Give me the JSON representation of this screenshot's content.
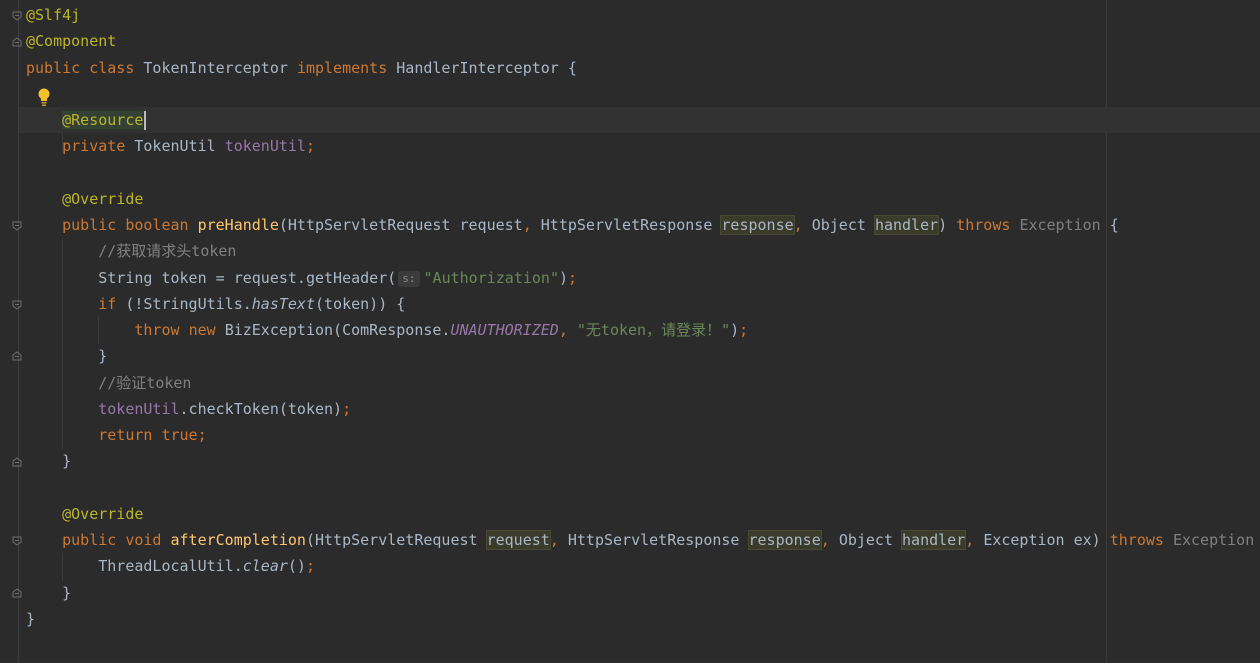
{
  "editor": {
    "lines": {
      "l1": "@Slf4j",
      "l2": "@Component",
      "l3": {
        "kw1": "public",
        "kw2": "class",
        "name": "TokenInterceptor",
        "kw3": "implements",
        "iface": "HandlerInterceptor",
        "brace": "{"
      },
      "l5": {
        "ann": "@Resource"
      },
      "l6": {
        "kw": "private",
        "type": "TokenUtil",
        "field": "tokenUtil",
        "semi": ";"
      },
      "l8": "@Override",
      "l9": {
        "kw1": "public",
        "kw2": "boolean",
        "method": "preHandle",
        "open": "(",
        "t1": "HttpServletRequest",
        "p1": "request",
        "comma1": ",",
        "t2": "HttpServletResponse",
        "p2": "response",
        "comma2": ",",
        "t3": "Object",
        "p3": "handler",
        "close": ")",
        "throws": "throws",
        "exc": "Exception",
        "brace": "{"
      },
      "l10": "//获取请求头token",
      "l11": {
        "a": "String token = request.getHeader(",
        "hint": "s:",
        "str": "\"Authorization\"",
        "b": ")",
        "semi": ";"
      },
      "l12": {
        "kw": "if",
        "a": " (!StringUtils.",
        "m": "hasText",
        "b": "(token)) {"
      },
      "l13": {
        "kw1": "throw",
        "kw2": "new",
        "a": "BizException(ComResponse.",
        "const": "UNAUTHORIZED",
        "comma": ",",
        "str": "\"无token，请登录！\"",
        "b": ")",
        "semi": ";"
      },
      "l14": "}",
      "l15": "//验证token",
      "l16": {
        "field": "tokenUtil",
        "a": ".checkToken(token)",
        "semi": ";"
      },
      "l17": {
        "kw": "return",
        "val": "true",
        "semi": ";"
      },
      "l18": "}",
      "l20": "@Override",
      "l21": {
        "kw1": "public",
        "kw2": "void",
        "method": "afterCompletion",
        "open": "(",
        "t1": "HttpServletRequest",
        "p1": "request",
        "comma1": ",",
        "t2": "HttpServletResponse",
        "p2": "response",
        "comma2": ",",
        "t3": "Object",
        "p3": "handler",
        "comma3": ",",
        "t4": "Exception ex)",
        "throws": "throws",
        "exc": "Exception"
      },
      "l22": {
        "a": "ThreadLocalUtil.",
        "m": "clear",
        "b": "()",
        "semi": ";"
      },
      "l23": "}",
      "l24": "}"
    },
    "colors": {
      "background": "#2b2b2b",
      "annotation": "#bbb529",
      "keyword": "#cc7832",
      "field": "#9876aa",
      "method": "#ffc66d",
      "string": "#6a8759",
      "comment": "#808080"
    },
    "icons": {
      "intention": "lightbulb-icon",
      "fold": "fold-marker-icon"
    }
  }
}
